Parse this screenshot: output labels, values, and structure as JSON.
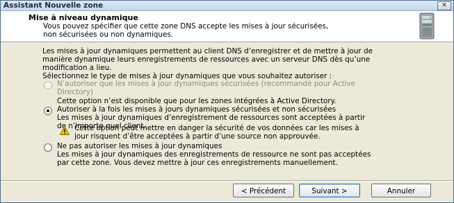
{
  "window": {
    "title": "Assistant Nouvelle zone",
    "close_glyph": "✕"
  },
  "header": {
    "title": "Mise à niveau dynamique",
    "subtitle_line1": "Vous pouvez spécifier que cette zone DNS accepte les mises à jour sécurisées,",
    "subtitle_line2": "non sécurisées ou non dynamiques.",
    "icon": "server-icon"
  },
  "intro": {
    "line1": "Les mises à jour dynamiques permettent au client DNS d’enregistrer et de mettre à jour de",
    "line2": "manière dynamique leurs enregistrements de ressources avec un serveur DNS dès qu’une",
    "line3": "modification a lieu.",
    "line4": "Sélectionnez le type de mises à jour dynamiques que vous souhaitez autoriser :"
  },
  "options": [
    {
      "label_line1": "N’autoriser que les mises à jour dynamiques sécurisées (recommandé pour Active",
      "label_line2": "Directory)",
      "desc_line1": "Cette option n’est disponible que pour les zones intégrées à Active Directory.",
      "enabled": false,
      "selected": false
    },
    {
      "label_line1": "Autoriser à la fois les mises à jours dynamiques sécurisées et non sécurisées",
      "desc_line1": "Les mises à jour dynamiques d’enregistrement de ressources sont acceptées à partir",
      "desc_line2": "de n’importe quel client.",
      "warning_line1": "Cette option peut mettre en danger la sécurité de vos données car les mises à",
      "warning_line2": "jour risquent d’être acceptées à partir d’une source non approuvée.",
      "enabled": true,
      "selected": true
    },
    {
      "label_line1": "Ne pas autoriser les mises à jour dynamiques",
      "desc_line1": "Les mises à jour dynamiques des enregistrements de ressource ne sont pas acceptées",
      "desc_line2": "par cette zone. Vous devez mettre à jour ces enregistrements manuellement.",
      "enabled": true,
      "selected": false
    }
  ],
  "buttons": {
    "back": "< Précédent",
    "next": "Suivant >",
    "cancel": "Annuler"
  },
  "colors": {
    "warning": "#f2c200",
    "header_bg": "#ffffff",
    "dialog_bg": "#ece9d8"
  }
}
